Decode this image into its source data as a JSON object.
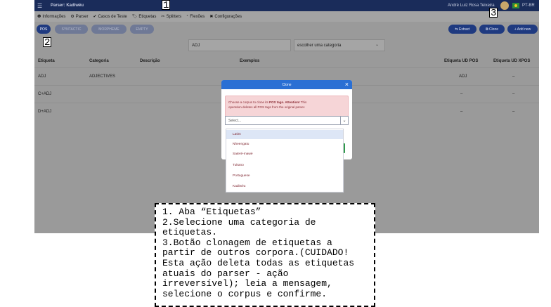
{
  "topbar": {
    "menu_icon": "hamburger-icon",
    "title": "Parser: Kadiwéu",
    "user": "André Luiz Rosa Teixeira",
    "lang": "PT-BR"
  },
  "menubar": [
    {
      "icon": "info-icon",
      "glyph": "❶",
      "label": "Informações"
    },
    {
      "icon": "parser-icon",
      "glyph": "⚙",
      "label": "Parser"
    },
    {
      "icon": "check-circle-icon",
      "glyph": "✔",
      "label": "Casos de Teste"
    },
    {
      "icon": "tag-icon",
      "glyph": "🏷",
      "label": "Etiquetas"
    },
    {
      "icon": "scissors-icon",
      "glyph": "✂",
      "label": "Splitters"
    },
    {
      "icon": "flexion-icon",
      "glyph": "⁺",
      "label": "Flexões"
    },
    {
      "icon": "tools-icon",
      "glyph": "✖",
      "label": "Configurações"
    }
  ],
  "pills": [
    "POS",
    "SYNTACTIC",
    "MORPHEME",
    "EMPTY"
  ],
  "actions": {
    "extract": "Extract",
    "clone": "Clone",
    "add_new": "+ Add new"
  },
  "filters": {
    "tag_value": "ADJ",
    "category_placeholder": "escolher uma categoria"
  },
  "table": {
    "headers": [
      "Etiqueta",
      "Categoria",
      "Descrição",
      "Exemplos",
      "Etiqueta UD POS",
      "Etiqueta UD XPOS"
    ],
    "rows": [
      {
        "tag": "ADJ",
        "category": "ADJECTIVES",
        "ud_pos": "ADJ",
        "ud_xpos": "–"
      },
      {
        "tag": "C+ADJ",
        "category": "",
        "ud_pos": "–",
        "ud_xpos": "–"
      },
      {
        "tag": "D+ADJ",
        "category": "",
        "ud_pos": "–",
        "ud_xpos": "–"
      }
    ]
  },
  "modal": {
    "title": "Clone",
    "alert_pre": "Choose a corpus to clone its ",
    "alert_bold": "POS tags. Attention!",
    "alert_post": " This",
    "alert_line2": "operation deletes all POS tags from the original parser.",
    "select_placeholder": "Select...",
    "options": [
      "Latim",
      "Nheengatu",
      "Sateré-mawé",
      "Tukano",
      "Portuguese",
      "Kadiwéu"
    ]
  },
  "callouts": [
    "1",
    "2",
    "3"
  ],
  "note_lines": [
    "1. Aba “Etiquetas”",
    "2.Selecione uma categoria de",
    "etiquetas.",
    "3.Botão clonagem de etiquetas a",
    "partir de outros corpora.(CUIDADO!",
    "Esta ação deleta todas as etiquetas",
    "atuais do parser - ação",
    "irreversível); leia a mensagem,",
    "selecione o corpus e confirme."
  ]
}
